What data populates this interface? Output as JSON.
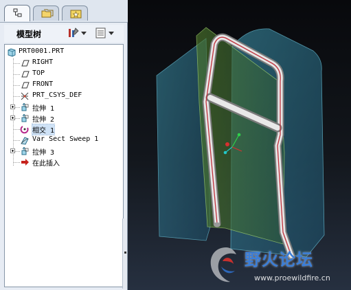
{
  "panel": {
    "title": "模型树",
    "tabs": [
      {
        "icon": "model-tree-icon",
        "active": true
      },
      {
        "icon": "folder-browser-icon",
        "active": false
      },
      {
        "icon": "favorites-icon",
        "active": false
      }
    ],
    "settings_button_icon": "tree-settings-icon",
    "show_button_icon": "tree-show-icon"
  },
  "tree": {
    "root": "PRT0001.PRT",
    "items": [
      {
        "label": "RIGHT",
        "icon": "datum-plane-icon",
        "expandable": false
      },
      {
        "label": "TOP",
        "icon": "datum-plane-icon",
        "expandable": false
      },
      {
        "label": "FRONT",
        "icon": "datum-plane-icon",
        "expandable": false
      },
      {
        "label": "PRT_CSYS_DEF",
        "icon": "csys-icon",
        "expandable": false
      },
      {
        "label": "拉伸 1",
        "icon": "extrude-icon",
        "expandable": true
      },
      {
        "label": "拉伸 2",
        "icon": "extrude-icon",
        "expandable": true
      },
      {
        "label": "相交 1",
        "icon": "intersect-icon",
        "expandable": false,
        "selected": true
      },
      {
        "label": "Var Sect Sweep 1",
        "icon": "sweep-icon",
        "expandable": false
      },
      {
        "label": "拉伸 3",
        "icon": "extrude-icon",
        "expandable": true
      },
      {
        "label": "在此插入",
        "icon": "insert-here-icon",
        "expandable": false
      }
    ]
  },
  "watermark": {
    "title": "野火论坛",
    "url": "www.proewildfire.cn"
  },
  "colors": {
    "panel_bg": "#e7ecf4",
    "viewport_top": "#08090c",
    "viewport_bottom": "#263040",
    "surface_blue": "#2a6f86",
    "surface_green": "#3d6b2a",
    "tube": "#c9c9c9",
    "curve_red": "#c0303a",
    "watermark_blue": "#3b7ed7"
  }
}
